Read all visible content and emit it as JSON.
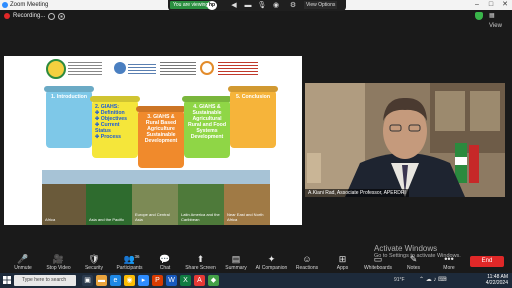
{
  "window": {
    "title": "Zoom Meeting"
  },
  "recording": {
    "text": "Recording..."
  },
  "share_bar": {
    "banner": "You are viewing",
    "brand": "hp",
    "view_options": "View Options"
  },
  "gallery": {
    "label": "▦ View"
  },
  "slide": {
    "cards": [
      {
        "label": "1. Introduction",
        "color": "#7ec8e8"
      },
      {
        "label": "2. GIAHS:\n✤ Definition\n✤ Objectives\n✤ Current Status\n✤ Process",
        "color": "#f5e63a"
      },
      {
        "label": "3. GIAHS & Rural Based Agriculture Sustainable Development",
        "color": "#f08a2c"
      },
      {
        "label": "4. GIAHS & Sustainable Agricultural Rural and Food Systems Development",
        "color": "#8fd646"
      },
      {
        "label": "5. Conclusion",
        "color": "#f6b43a"
      }
    ],
    "photos": [
      {
        "caption": "Africa"
      },
      {
        "caption": "Asia and the Pacific"
      },
      {
        "caption": "Europe and Central Asia"
      },
      {
        "caption": "Latin America and the Caribbean"
      },
      {
        "caption": "Near East and North Africa"
      }
    ]
  },
  "speaker": {
    "name": "A.Kiani Rad, Associate Professor, APERDRI"
  },
  "watermark": {
    "title": "Activate Windows",
    "subtitle": "Go to Settings to activate Windows."
  },
  "toolbar": {
    "items": [
      {
        "name": "unmute",
        "label": "Unmute",
        "icon": "🎤"
      },
      {
        "name": "stop-video",
        "label": "Stop Video",
        "icon": "🎥"
      },
      {
        "name": "security",
        "label": "Security",
        "icon": "🛡"
      },
      {
        "name": "participants",
        "label": "Participants",
        "icon": "👥",
        "badge": "36"
      },
      {
        "name": "chat",
        "label": "Chat",
        "icon": "💬"
      },
      {
        "name": "share-screen",
        "label": "Share Screen",
        "icon": "⬆"
      },
      {
        "name": "summary",
        "label": "Summary",
        "icon": "▤"
      },
      {
        "name": "ai-companion",
        "label": "AI Companion",
        "icon": "✦"
      },
      {
        "name": "reactions",
        "label": "Reactions",
        "icon": "☺"
      },
      {
        "name": "apps",
        "label": "Apps",
        "icon": "⊞"
      },
      {
        "name": "whiteboards",
        "label": "Whiteboards",
        "icon": "▭"
      },
      {
        "name": "notes",
        "label": "Notes",
        "icon": "✎"
      },
      {
        "name": "more",
        "label": "More",
        "icon": "•••"
      }
    ],
    "end": "End"
  },
  "taskbar": {
    "search_placeholder": "Type here to search",
    "temperature": "91°F",
    "time": "11:48 AM",
    "date": "4/22/2024"
  }
}
